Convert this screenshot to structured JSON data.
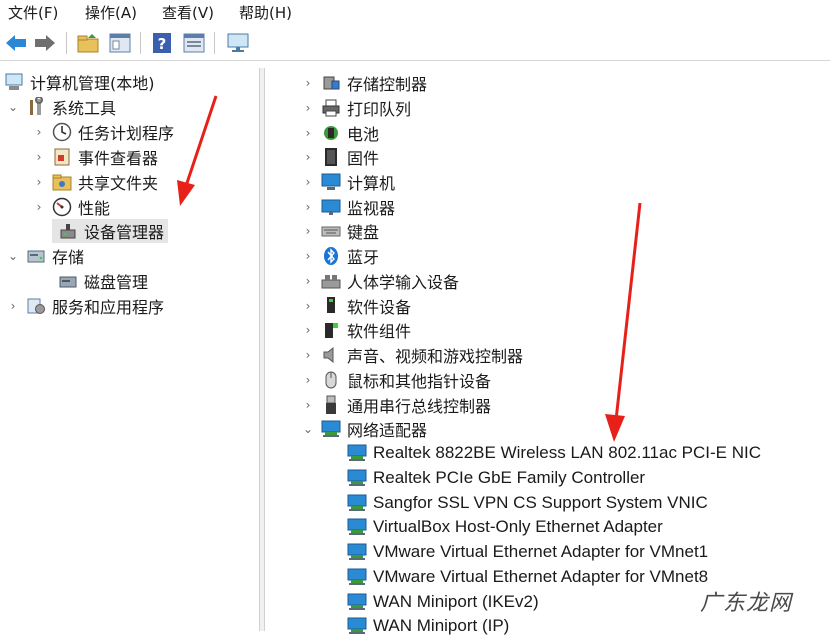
{
  "menubar": {
    "items": [
      {
        "label": "文件(F)"
      },
      {
        "label": "操作(A)"
      },
      {
        "label": "查看(V)"
      },
      {
        "label": "帮助(H)"
      }
    ]
  },
  "toolbar": {
    "buttons": [
      "back-icon",
      "forward-icon",
      "up-folder-icon",
      "show-hide-tree-icon",
      "help-icon",
      "properties-icon",
      "monitor-icon"
    ]
  },
  "left_tree": {
    "root": "计算机管理(本地)",
    "system_tools": "系统工具",
    "task_scheduler": "任务计划程序",
    "event_viewer": "事件查看器",
    "shared_folders": "共享文件夹",
    "performance": "性能",
    "device_manager": "设备管理器",
    "storage": "存储",
    "disk_management": "磁盘管理",
    "services_apps": "服务和应用程序"
  },
  "device_tree": {
    "categories": [
      "存储控制器",
      "打印队列",
      "电池",
      "固件",
      "计算机",
      "监视器",
      "键盘",
      "蓝牙",
      "人体学输入设备",
      "软件设备",
      "软件组件",
      "声音、视频和游戏控制器",
      "鼠标和其他指针设备",
      "通用串行总线控制器",
      "网络适配器"
    ],
    "network_adapters": [
      "Realtek 8822BE Wireless LAN 802.11ac PCI-E NIC",
      "Realtek PCIe GbE Family Controller",
      "Sangfor SSL VPN CS Support System VNIC",
      "VirtualBox Host-Only Ethernet Adapter",
      "VMware Virtual Ethernet Adapter for VMnet1",
      "VMware Virtual Ethernet Adapter for VMnet8",
      "WAN Miniport (IKEv2)",
      "WAN Miniport (IP)"
    ]
  },
  "watermark": "广东龙网",
  "colors": {
    "arrow": "#e8201a",
    "network_icon": "#2a8ad4",
    "selection": "#e5e5e5"
  }
}
